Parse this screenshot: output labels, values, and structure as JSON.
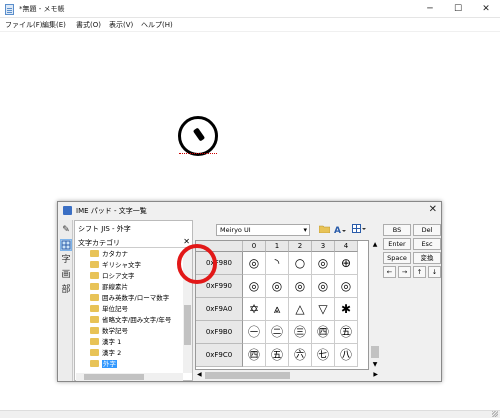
{
  "window": {
    "title": "*無題 - メモ帳",
    "minimize": "─",
    "maximize": "☐",
    "close": "✕"
  },
  "menu": [
    "ファイル(F)",
    "編集(E)",
    "書式(O)",
    "表示(V)",
    "ヘルプ(H)"
  ],
  "ime": {
    "title": "IME パッド - 文字一覧",
    "close": "✕",
    "tools": [
      "✎",
      "字",
      "画",
      "部"
    ],
    "encoding": "シフト JIS - 外字",
    "category_header": "文字カテゴリ",
    "category_close": "✕",
    "categories": [
      "カタカナ",
      "ギリシャ文字",
      "ロシア文字",
      "罫線素片",
      "囲み英数字/ローマ数字",
      "単位記号",
      "省略文字/囲み文字/年号",
      "数学記号",
      "漢字 1",
      "漢字 2",
      "外字"
    ],
    "selected_category": "外字",
    "font": "Meiryo UI",
    "columns": [
      "0",
      "1",
      "2",
      "3",
      "4"
    ],
    "rows": [
      {
        "code": "0xF980",
        "chars": [
          "◎",
          "◝",
          "○",
          "◎",
          "⊕"
        ]
      },
      {
        "code": "0xF990",
        "chars": [
          "◎",
          "◎",
          "◎",
          "◎",
          "◎"
        ]
      },
      {
        "code": "0xF9A0",
        "chars": [
          "✡",
          "⩓",
          "△",
          "▽",
          "✱"
        ]
      },
      {
        "code": "0xF9B0",
        "chars": [
          "㊀",
          "㊁",
          "㊂",
          "㊃",
          "㊄"
        ]
      },
      {
        "code": "0xF9C0",
        "chars": [
          "㊃",
          "㊄",
          "㊅",
          "㊆",
          "㊇"
        ]
      }
    ],
    "keys": [
      "BS",
      "Del",
      "Enter",
      "Esc",
      "Space",
      "変換",
      "←",
      "→",
      "↑",
      "↓"
    ]
  },
  "colors": {
    "highlight": "#e21818",
    "selection": "#3399ff"
  }
}
